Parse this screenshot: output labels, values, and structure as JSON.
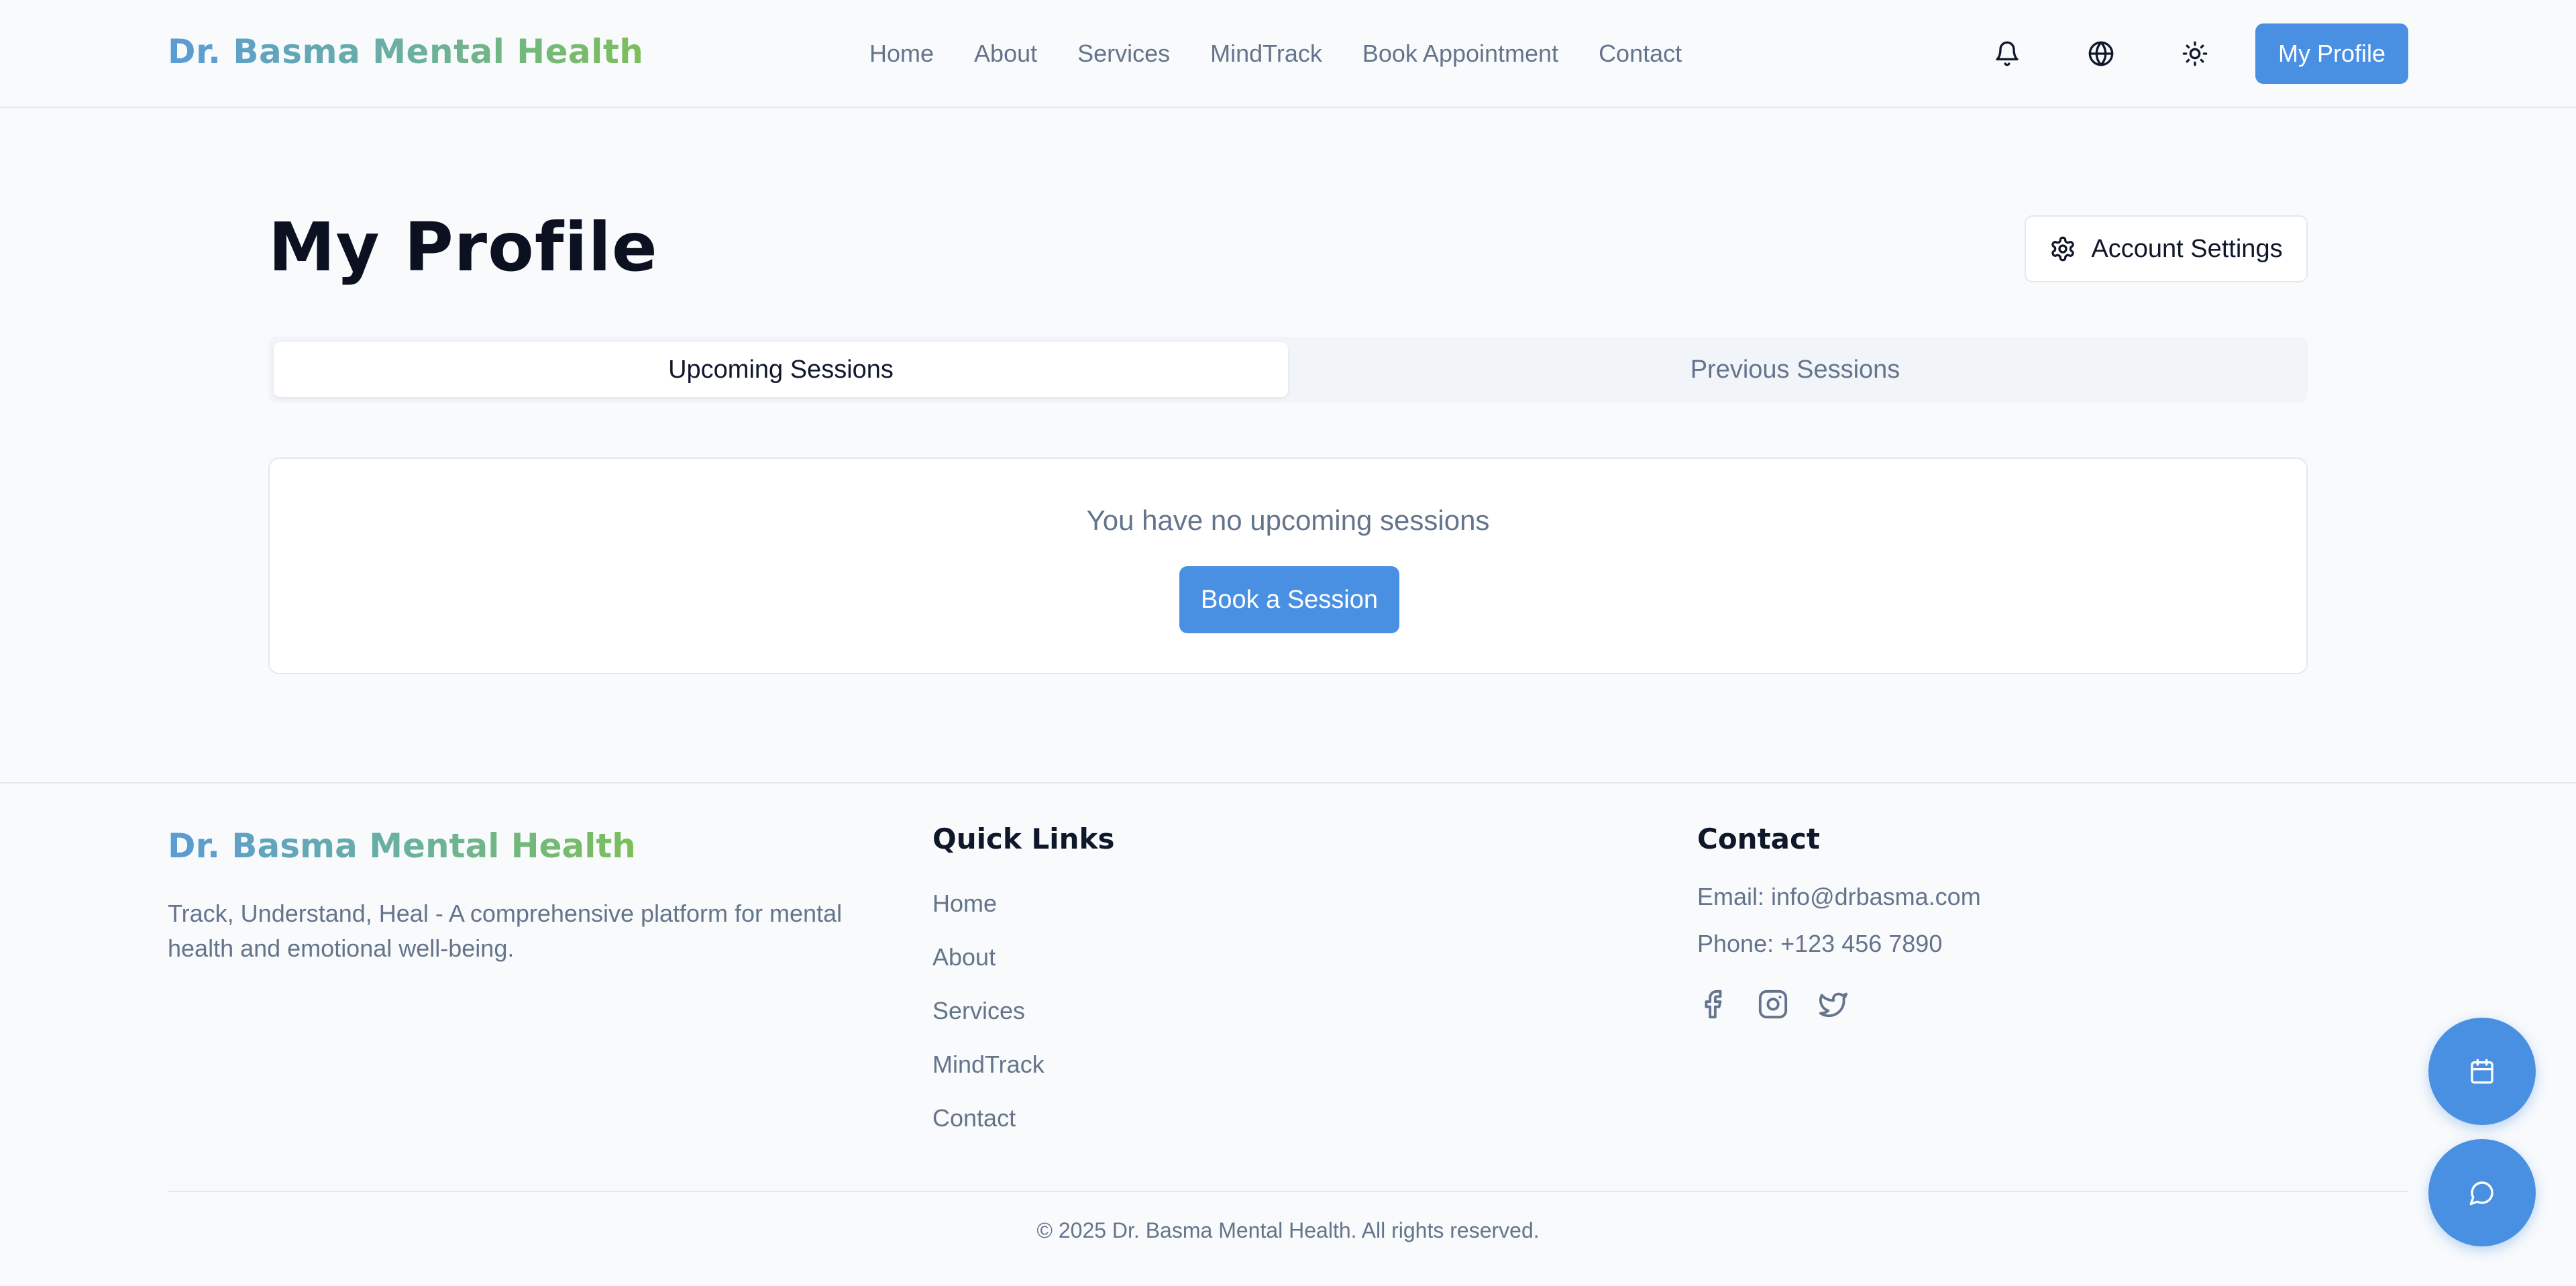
{
  "header": {
    "brand": "Dr. Basma Mental Health",
    "nav": [
      "Home",
      "About",
      "Services",
      "MindTrack",
      "Book Appointment",
      "Contact"
    ],
    "icons": {
      "notifications": "bell-icon",
      "language": "globe-icon",
      "theme": "sun-icon"
    },
    "profile_button": "My Profile"
  },
  "main": {
    "title": "My Profile",
    "settings_button": "Account Settings",
    "tabs": [
      {
        "label": "Upcoming Sessions",
        "active": true
      },
      {
        "label": "Previous Sessions",
        "active": false
      }
    ],
    "empty_message": "You have no upcoming sessions",
    "book_button": "Book a Session"
  },
  "footer": {
    "brand": "Dr. Basma Mental Health",
    "description": "Track, Understand, Heal - A comprehensive platform for mental health and emotional well-being.",
    "quick_links_heading": "Quick Links",
    "quick_links": [
      "Home",
      "About",
      "Services",
      "MindTrack",
      "Contact"
    ],
    "contact_heading": "Contact",
    "email": "Email: info@drbasma.com",
    "phone": "Phone: +123 456 7890",
    "socials": [
      "facebook-icon",
      "instagram-icon",
      "twitter-icon"
    ],
    "copyright": "© 2025 Dr. Basma Mental Health. All rights reserved."
  },
  "floating": {
    "calendar": "calendar-icon",
    "chat": "chat-icon"
  },
  "colors": {
    "accent": "#4a90e2",
    "muted_text": "#64748b",
    "background": "#f8fafc",
    "brand_gradient": [
      "#5b9bd5",
      "#7cbf5a"
    ]
  }
}
